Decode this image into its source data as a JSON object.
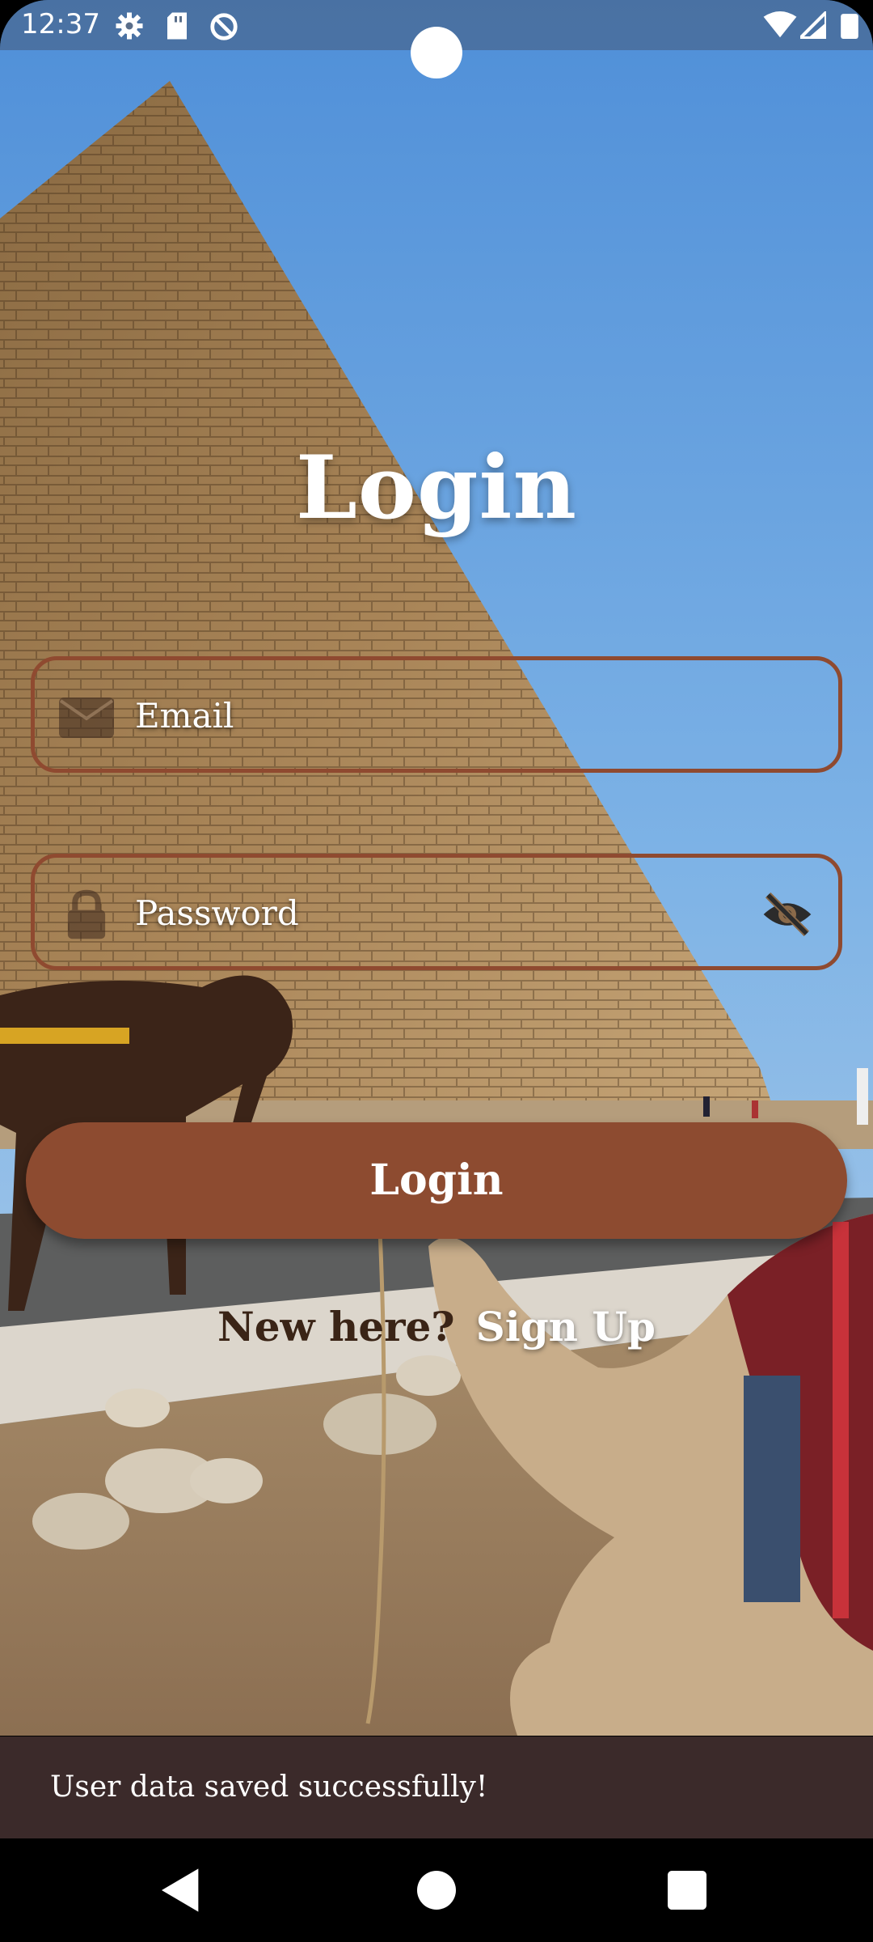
{
  "status_bar": {
    "time": "12:37",
    "left_icons": [
      "settings-icon",
      "sd-card-icon",
      "data-saver-icon"
    ],
    "right_icons": [
      "wifi-icon",
      "cellular-signal-icon",
      "battery-icon"
    ]
  },
  "login": {
    "title": "Login",
    "email": {
      "placeholder": "Email",
      "icon": "email-icon"
    },
    "password": {
      "placeholder": "Password",
      "icon": "lock-icon",
      "toggle_icon": "visibility-off-icon"
    },
    "button_label": "Login",
    "new_here_text": "New here?",
    "signup_link": "Sign Up"
  },
  "snackbar": {
    "message": "User data saved successfully!"
  },
  "navigation_bar": {
    "buttons": [
      "back-icon",
      "home-icon",
      "recents-icon"
    ]
  },
  "colors": {
    "accent": "#8d4b30",
    "field_border": "#8f4a30",
    "snackbar_bg": "#3b2a2a",
    "signup_prompt": "#3a2416"
  }
}
